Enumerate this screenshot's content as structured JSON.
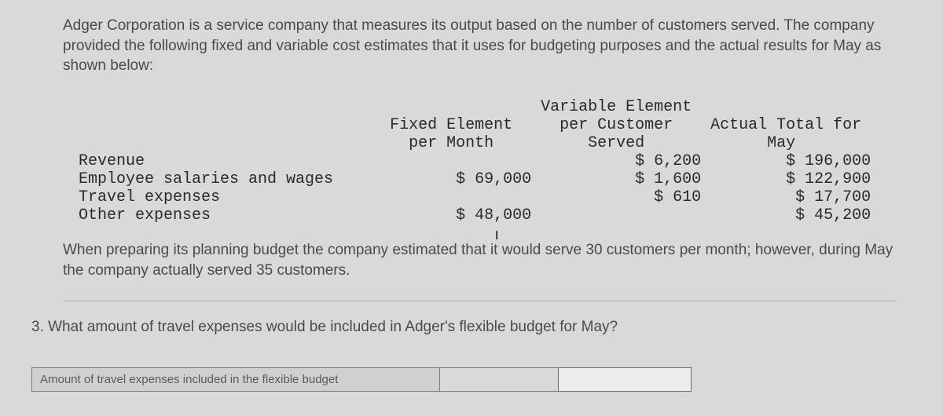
{
  "intro": "Adger Corporation is a service company that measures its output based on the number of customers served. The company provided the following fixed and variable cost estimates that it uses for budgeting purposes and the actual results for May as shown below:",
  "table": {
    "col_headers": {
      "fixed": "Fixed Element\nper Month",
      "variable": "Variable Element\nper Customer\nServed",
      "actual": "Actual Total for\nMay"
    },
    "rows": [
      {
        "label": "Revenue",
        "fixed": "",
        "variable": "$ 6,200",
        "actual": "$ 196,000"
      },
      {
        "label": "Employee salaries and wages",
        "fixed": "$ 69,000",
        "variable": "$ 1,600",
        "actual": "$ 122,900"
      },
      {
        "label": "Travel expenses",
        "fixed": "",
        "variable": "$ 610",
        "actual": "$ 17,700"
      },
      {
        "label": "Other expenses",
        "fixed": "$ 48,000",
        "variable": "",
        "actual": "$ 45,200"
      }
    ]
  },
  "followup": "When preparing its planning budget the company estimated that it would serve 30 customers per month; however, during May the company actually served 35 customers.",
  "question": "3. What amount of travel expenses would be included in Adger's flexible budget for May?",
  "answer_label": "Amount of travel expenses included in the flexible budget",
  "answer_value": ""
}
